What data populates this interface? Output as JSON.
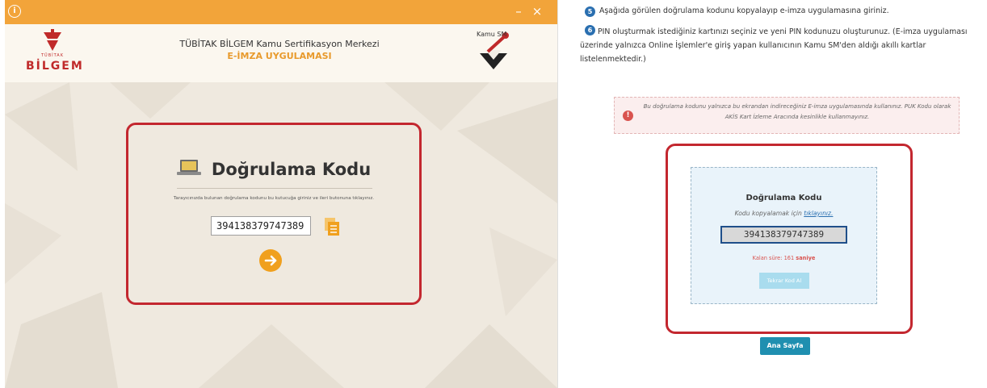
{
  "app": {
    "titlebar": {
      "info_glyph": "i",
      "minimize_glyph": "–",
      "close_glyph": "×"
    },
    "header": {
      "logo_left_small": "TÜBİTAK",
      "logo_left_text": "BİLGEM",
      "title": "TÜBİTAK BİLGEM Kamu Sertifikasyon Merkezi",
      "subtitle": "E-İMZA UYGULAMASI",
      "logo_right_text": "Kamu SM"
    },
    "verification": {
      "title": "Doğrulama Kodu",
      "instruction": "Tarayıcınızda bulunan doğrulama kodunu bu kutucuğa giriniz ve ileri butonuna tıklayınız.",
      "code_value": "394138379747389",
      "icons": {
        "title": "laptop-icon",
        "copy": "copy-icon",
        "next": "arrow-right-icon"
      }
    },
    "colors": {
      "titlebar": "#f2a43a",
      "accent": "#f0a01e",
      "highlight_border": "#c3272f"
    }
  },
  "web": {
    "step5": {
      "number": "5",
      "text": "Aşağıda görülen doğrulama kodunu kopyalayıp e-imza uygulamasına giriniz."
    },
    "step6": {
      "number": "6",
      "text": "PIN oluşturmak istediğiniz kartınızı seçiniz ve yeni PIN kodunuzu oluşturunuz. (E-imza uygulaması üzerinde yalnızca Online İşlemler'e giriş yapan kullanıcının Kamu SM'den aldığı akıllı kartlar listelenmektedir.)"
    },
    "warning": {
      "icon": "!",
      "text": "Bu doğrulama kodunu yalnızca bu ekrandan indireceğiniz E-imza uygulamasında kullanınız. PUK Kodu olarak AKİS Kart İzleme Aracında kesinlikle kullanmayınız."
    },
    "card": {
      "title": "Doğrulama Kodu",
      "hint_prefix": "Kodu kopyalamak için",
      "hint_link": "tıklayınız.",
      "code_value": "394138379747389",
      "timer_label": "Kalan süre:",
      "timer_value": "161",
      "timer_unit": "saniye",
      "retry_label": "Tekrar Kod Al"
    },
    "home_button_label": "Ana Sayfa",
    "colors": {
      "step_badge": "#2a6fb0",
      "warning_bg": "#fbeeee",
      "card_bg": "#e9f3fa",
      "home_button": "#1f8fb0"
    }
  }
}
